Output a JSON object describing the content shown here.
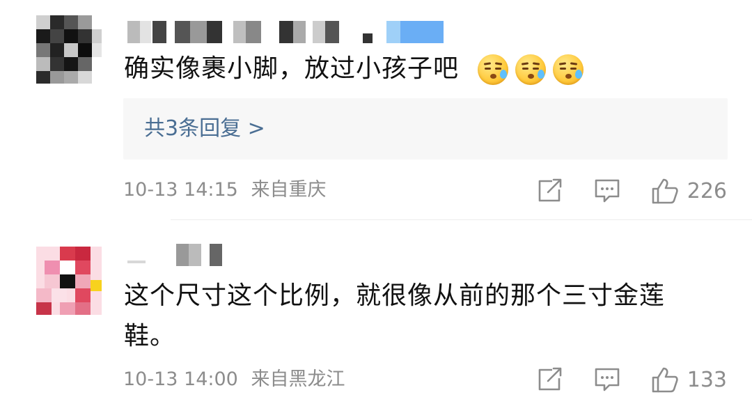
{
  "comments": [
    {
      "text": "确实像裹小脚，放过小孩子吧",
      "emojis": [
        "sweat-emoji",
        "sweat-emoji",
        "sweat-emoji"
      ],
      "reply_link": "共3条回复 >",
      "timestamp": "10-13 14:15",
      "location": "来自重庆",
      "likes": "226"
    },
    {
      "text": "这个尺寸这个比例，就很像从前的那个三寸金莲鞋。",
      "timestamp": "10-13 14:00",
      "location": "来自黑龙江",
      "likes": "133"
    }
  ],
  "icons": {
    "share": "share-icon",
    "comment": "comment-icon",
    "like": "thumbs-up-icon"
  },
  "colors": {
    "link": "#4a6e93",
    "meta": "#8c8c8c",
    "reply_bg": "#f7f7f7",
    "name_highlight": "#6aaef5"
  }
}
